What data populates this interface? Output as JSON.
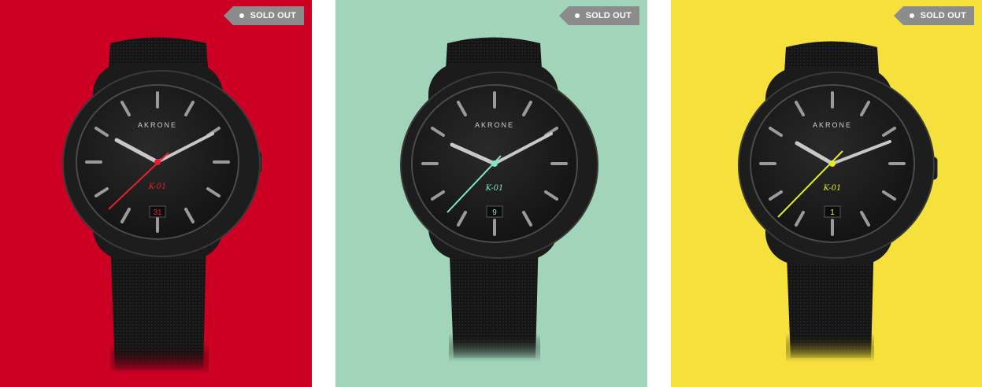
{
  "products": [
    {
      "id": "red",
      "background": "#cc0022",
      "accent": "#e8202e",
      "badge": "SOLD OUT",
      "brand": "AKRONE",
      "model": "K-01",
      "date": "31"
    },
    {
      "id": "mint",
      "background": "#a1d4b9",
      "accent": "#7fe7c4",
      "badge": "SOLD OUT",
      "brand": "AKRONE",
      "model": "K-01",
      "date": "9"
    },
    {
      "id": "yellow",
      "background": "#f5e03c",
      "accent": "#e6e82c",
      "badge": "SOLD OUT",
      "brand": "AKRONE",
      "model": "K-01",
      "date": "1"
    }
  ]
}
